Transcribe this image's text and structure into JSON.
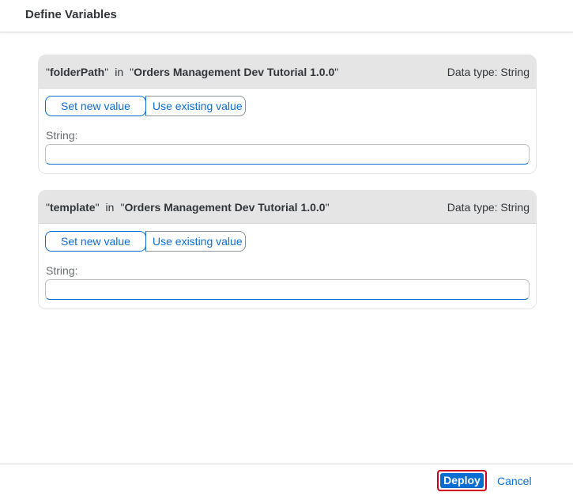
{
  "dialog": {
    "title": "Define Variables"
  },
  "variables": [
    {
      "name": "folderPath",
      "in_word": "in",
      "scope": "Orders Management Dev Tutorial 1.0.0",
      "data_type": "Data type: String",
      "set_new_label": "Set new value",
      "use_existing_label": "Use existing value",
      "field_label": "String:",
      "field_value": ""
    },
    {
      "name": "template",
      "in_word": "in",
      "scope": "Orders Management Dev Tutorial 1.0.0",
      "data_type": "Data type: String",
      "set_new_label": "Set new value",
      "use_existing_label": "Use existing value",
      "field_label": "String:",
      "field_value": ""
    }
  ],
  "footer": {
    "deploy_label": "Deploy",
    "cancel_label": "Cancel"
  },
  "colors": {
    "accent": "#0a6ed1",
    "highlight": "#d0021b",
    "panel_header": "#e5e5e5"
  }
}
